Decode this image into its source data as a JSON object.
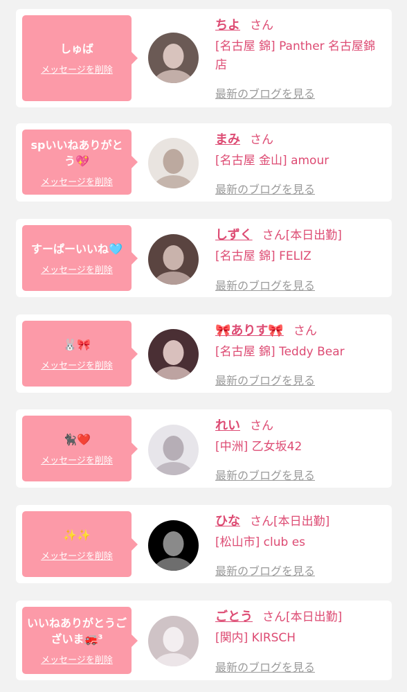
{
  "common": {
    "delete_label": "メッセージを削除",
    "san": "さん",
    "blog_label": "最新のブログを見る"
  },
  "items": [
    {
      "message": "しゅば",
      "name": "ちよ",
      "status": "",
      "shop": "[名古屋 錦] Panther 名古屋錦店",
      "avatar": {
        "bg": "#6b5a55",
        "fg": "#d8c3bd"
      }
    },
    {
      "message": "spいいねありがとう💖",
      "name": "まみ",
      "status": "",
      "shop": "[名古屋 金山] amour",
      "avatar": {
        "bg": "#e9e4e0",
        "fg": "#bca99f"
      }
    },
    {
      "message": "すーぱーいいね🩵",
      "name": "しずく",
      "status": "[本日出勤]",
      "shop": "[名古屋 錦] FELIZ",
      "avatar": {
        "bg": "#5a4440",
        "fg": "#c9b3ac"
      }
    },
    {
      "message": "🐰🎀",
      "name": "🎀ありす🎀",
      "status": "",
      "shop": "[名古屋 錦] Teddy Bear",
      "avatar": {
        "bg": "#4a2f34",
        "fg": "#d9c0bd"
      }
    },
    {
      "message": "🐈‍⬛❤️",
      "name": "れい",
      "status": "",
      "shop": "[中洲] 乙女坂42",
      "avatar": {
        "bg": "#e7e5ea",
        "fg": "#b6aeb6"
      }
    },
    {
      "message": "✨✨",
      "name": "ひな",
      "status": "[本日出勤]",
      "shop": "[松山市] club es",
      "avatar": {
        "bg": "#000000",
        "fg": "#8a8a8a"
      }
    },
    {
      "message": "いいねありがとうございま🚒³",
      "name": "ごとう",
      "status": "[本日出勤]",
      "shop": "[関内] KIRSCH",
      "avatar": {
        "bg": "#cfc3c6",
        "fg": "#f3eef0"
      }
    }
  ],
  "colors": {
    "accent": "#dd4b73",
    "bubble": "#fc9aa8",
    "muted": "#9a9a9a"
  }
}
